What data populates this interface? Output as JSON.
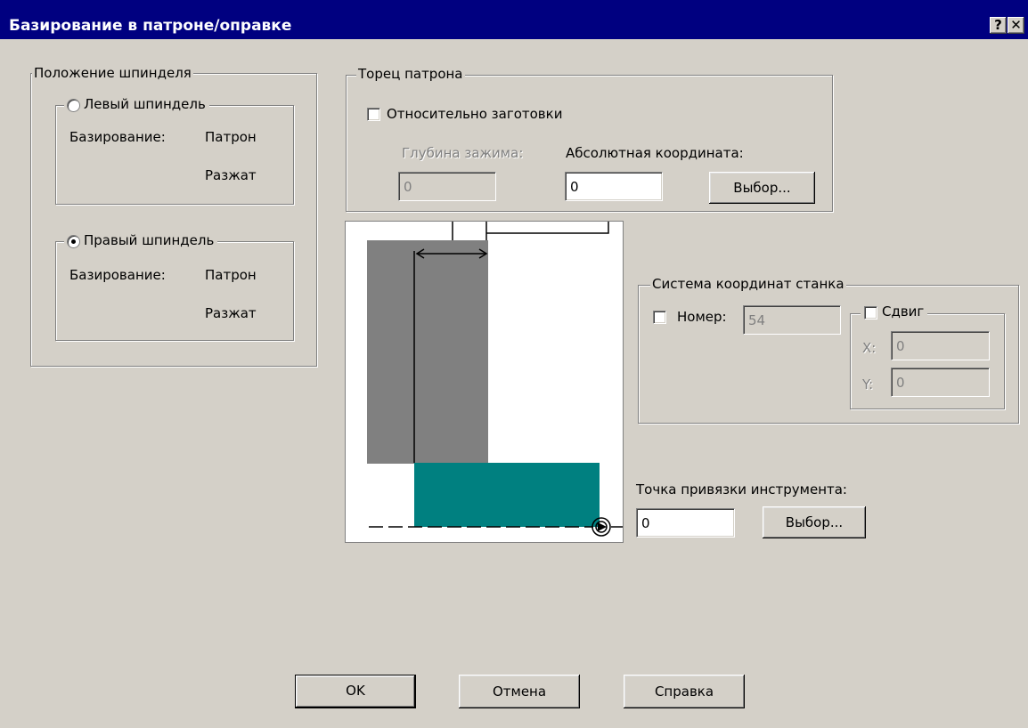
{
  "window": {
    "title": "Базирование в патроне/оправке",
    "help_btn": "?",
    "close_btn": "✕"
  },
  "spindle": {
    "legend": "Положение шпинделя",
    "left": {
      "label": "Левый шпиндель",
      "selected": false,
      "basing_label": "Базирование:",
      "basing_value": "Патрон",
      "state": "Разжат"
    },
    "right": {
      "label": "Правый шпиндель",
      "selected": true,
      "basing_label": "Базирование:",
      "basing_value": "Патрон",
      "state": "Разжат"
    }
  },
  "chuck_face": {
    "legend": "Торец патрона",
    "relative_label": "Относительно заготовки",
    "relative_checked": false,
    "depth_label": "Глубина зажима:",
    "depth_value": "0",
    "abs_label": "Абсолютная координата:",
    "abs_value": "0",
    "select_label": "Выбор..."
  },
  "machine_cs": {
    "legend": "Система координат станка",
    "number_label": "Номер:",
    "number_checked": false,
    "number_value": "54",
    "shift_label": "Сдвиг",
    "shift_checked": false,
    "x_label": "X:",
    "x_value": "0",
    "y_label": "Y:",
    "y_value": "0"
  },
  "tool_point": {
    "label": "Точка привязки инструмента:",
    "value": "0",
    "select_label": "Выбор..."
  },
  "buttons": {
    "ok": "OK",
    "cancel": "Отмена",
    "help": "Справка"
  },
  "colors": {
    "title_bar": "#000080",
    "chuck": "#808080",
    "workpiece": "#008080"
  }
}
